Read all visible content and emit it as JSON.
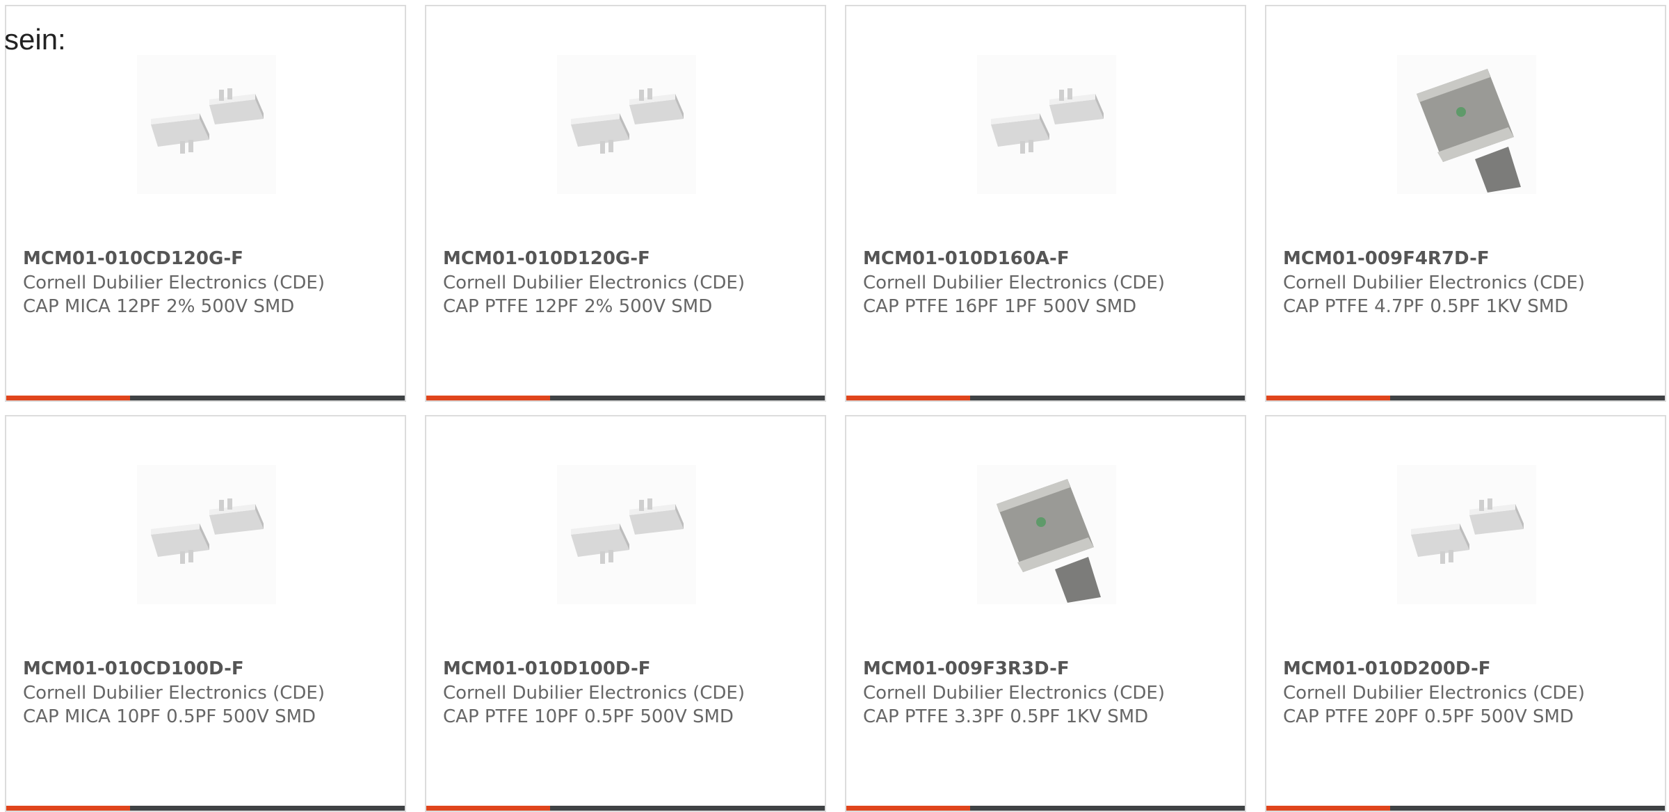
{
  "intro_text": "sein:",
  "colors": {
    "accent": "#e0451c",
    "bar_track": "#3f4244",
    "card_border": "#dcdcdc"
  },
  "products": [
    {
      "part": "MCM01-010CD120G-F",
      "manufacturer": "Cornell Dubilier Electronics (CDE)",
      "description": "CAP MICA 12PF 2% 500V SMD",
      "image": "twin-capacitor-image",
      "accent_fraction": 0.31
    },
    {
      "part": "MCM01-010D120G-F",
      "manufacturer": "Cornell Dubilier Electronics (CDE)",
      "description": "CAP PTFE 12PF 2% 500V SMD",
      "image": "twin-capacitor-image",
      "accent_fraction": 0.31
    },
    {
      "part": "MCM01-010D160A-F",
      "manufacturer": "Cornell Dubilier Electronics (CDE)",
      "description": "CAP PTFE 16PF 1PF 500V SMD",
      "image": "twin-capacitor-image",
      "accent_fraction": 0.31
    },
    {
      "part": "MCM01-009F4R7D-F",
      "manufacturer": "Cornell Dubilier Electronics (CDE)",
      "description": "CAP PTFE 4.7PF 0.5PF 1KV SMD",
      "image": "mica-chip-image",
      "accent_fraction": 0.31
    },
    {
      "part": "MCM01-010CD100D-F",
      "manufacturer": "Cornell Dubilier Electronics (CDE)",
      "description": "CAP MICA 10PF 0.5PF 500V SMD",
      "image": "twin-capacitor-image",
      "accent_fraction": 0.31
    },
    {
      "part": "MCM01-010D100D-F",
      "manufacturer": "Cornell Dubilier Electronics (CDE)",
      "description": "CAP PTFE 10PF 0.5PF 500V SMD",
      "image": "twin-capacitor-image",
      "accent_fraction": 0.31
    },
    {
      "part": "MCM01-009F3R3D-F",
      "manufacturer": "Cornell Dubilier Electronics (CDE)",
      "description": "CAP PTFE 3.3PF 0.5PF 1KV SMD",
      "image": "mica-chip-image",
      "accent_fraction": 0.31
    },
    {
      "part": "MCM01-010D200D-F",
      "manufacturer": "Cornell Dubilier Electronics (CDE)",
      "description": "CAP PTFE 20PF 0.5PF 500V SMD",
      "image": "twin-capacitor-image",
      "accent_fraction": 0.31
    }
  ]
}
